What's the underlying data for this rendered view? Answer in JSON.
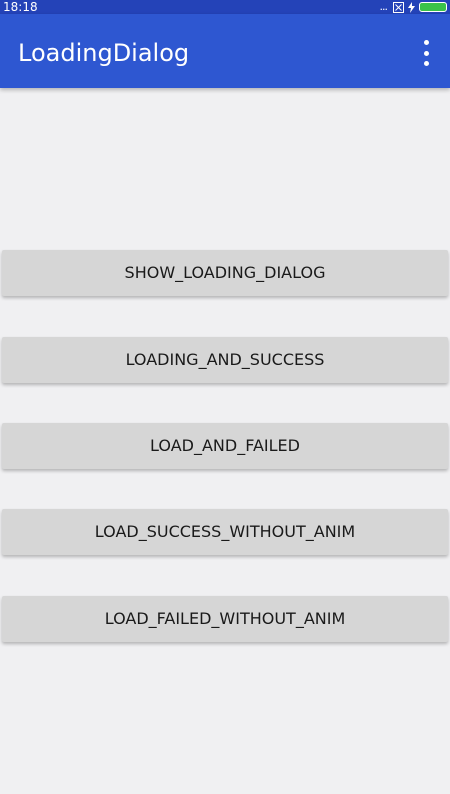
{
  "status_bar": {
    "time": "18:18",
    "dots": "...",
    "sim_icon": "sim-card-icon",
    "charging_icon": "lightning-icon",
    "battery_icon": "battery-icon",
    "battery_color": "#3ac24a"
  },
  "app_bar": {
    "title": "LoadingDialog",
    "menu_icon": "more-vertical-icon",
    "color": "#2e57d1"
  },
  "buttons": [
    {
      "label": "SHOW_LOADING_DIALOG"
    },
    {
      "label": "LOADING_AND_SUCCESS"
    },
    {
      "label": "LOAD_AND_FAILED"
    },
    {
      "label": "LOAD_SUCCESS_WITHOUT_ANIM"
    },
    {
      "label": "LOAD_FAILED_WITHOUT_ANIM"
    }
  ]
}
